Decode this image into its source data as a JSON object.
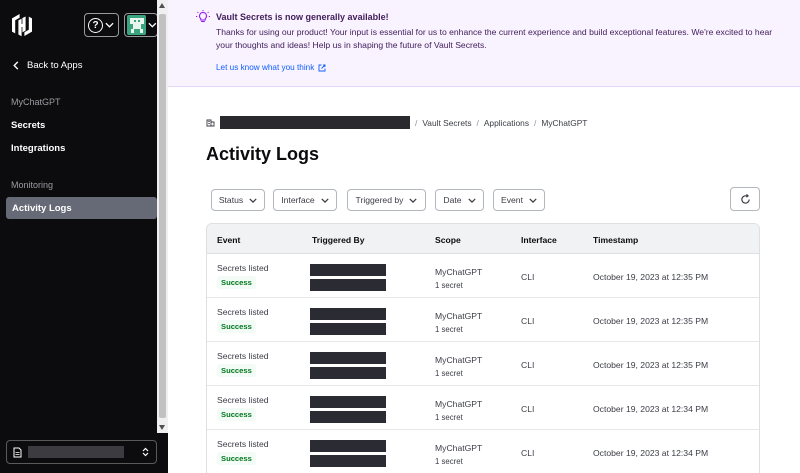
{
  "sidebar": {
    "back_label": "Back to Apps",
    "org_name": "MyChatGPT",
    "items": [
      {
        "label": "Secrets"
      },
      {
        "label": "Integrations"
      }
    ],
    "monitoring_label": "Monitoring",
    "active_item": "Activity Logs"
  },
  "banner": {
    "title": "Vault Secrets is now generally available!",
    "body": "Thanks for using our product! Your input is essential for us to enhance the current experience and build exceptional features. We're excited to hear your thoughts and ideas! Help us in shaping the future of Vault Secrets.",
    "link": "Let us know what you think"
  },
  "breadcrumb": {
    "items": [
      "Vault Secrets",
      "Applications",
      "MyChatGPT"
    ]
  },
  "page_title": "Activity Logs",
  "filters": [
    "Status",
    "Interface",
    "Triggered by",
    "Date",
    "Event"
  ],
  "table": {
    "columns": [
      "Event",
      "Triggered By",
      "Scope",
      "Interface",
      "Timestamp"
    ],
    "rows": [
      {
        "event": "Secrets listed",
        "status": "Success",
        "scope": "MyChatGPT",
        "scope_detail": "1 secret",
        "interface": "CLI",
        "timestamp": "October 19, 2023 at 12:35 PM"
      },
      {
        "event": "Secrets listed",
        "status": "Success",
        "scope": "MyChatGPT",
        "scope_detail": "1 secret",
        "interface": "CLI",
        "timestamp": "October 19, 2023 at 12:35 PM"
      },
      {
        "event": "Secrets listed",
        "status": "Success",
        "scope": "MyChatGPT",
        "scope_detail": "1 secret",
        "interface": "CLI",
        "timestamp": "October 19, 2023 at 12:35 PM"
      },
      {
        "event": "Secrets listed",
        "status": "Success",
        "scope": "MyChatGPT",
        "scope_detail": "1 secret",
        "interface": "CLI",
        "timestamp": "October 19, 2023 at 12:34 PM"
      },
      {
        "event": "Secrets listed",
        "status": "Success",
        "scope": "MyChatGPT",
        "scope_detail": "1 secret",
        "interface": "CLI",
        "timestamp": "October 19, 2023 at 12:34 PM"
      }
    ]
  },
  "colors": {
    "sidebar_bg": "#0c0c0e",
    "active_nav": "#656a76",
    "banner_bg": "#f9f2ff",
    "banner_text": "#42215b",
    "link": "#1060ff",
    "success_text": "#00781e"
  }
}
